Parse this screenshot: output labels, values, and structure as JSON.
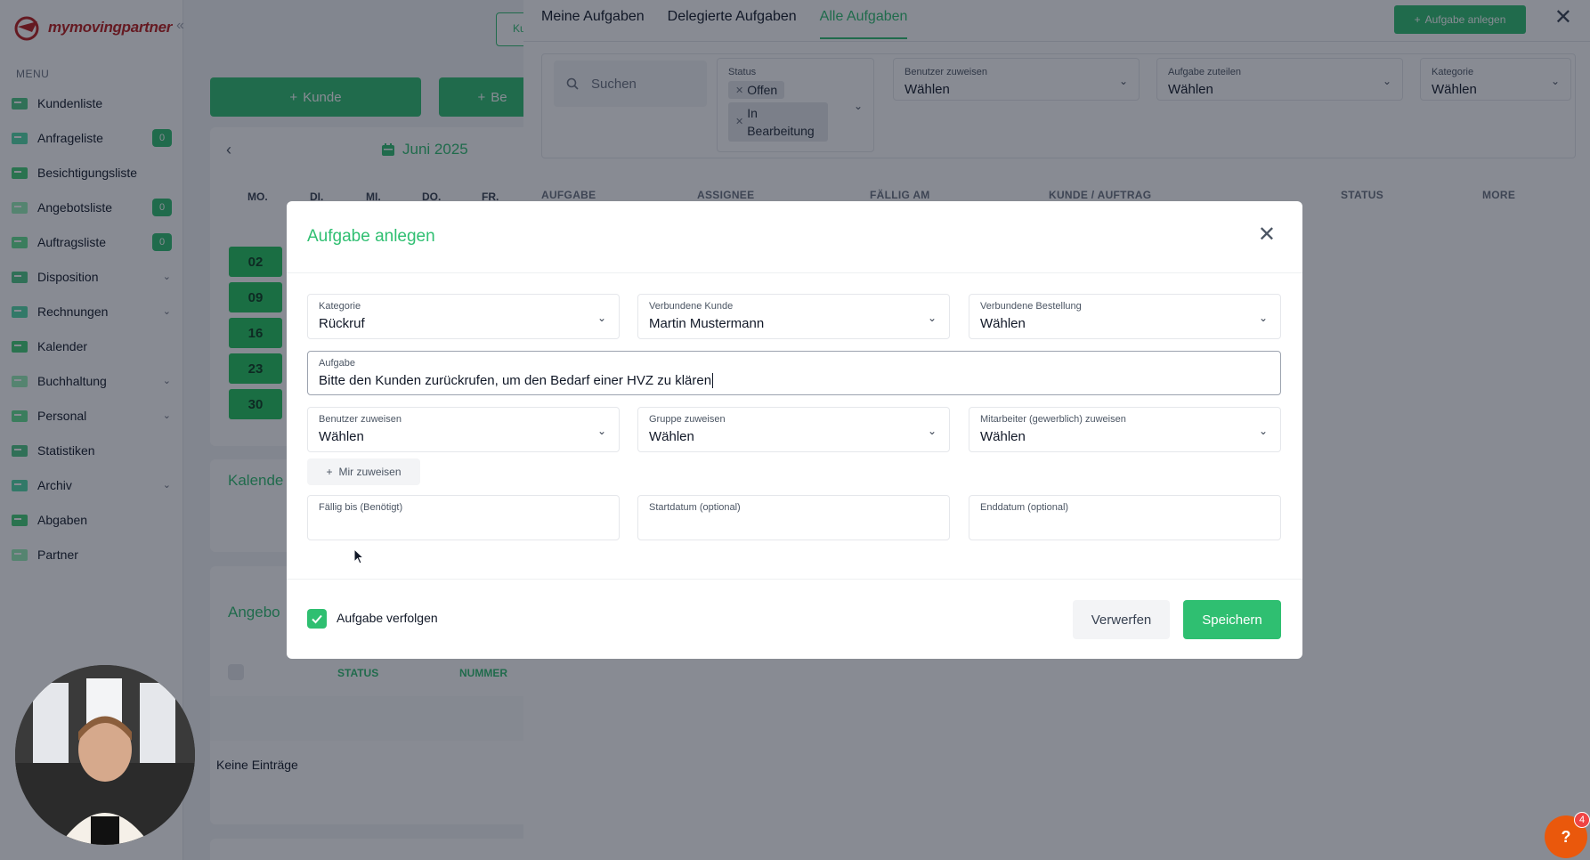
{
  "sidebar": {
    "brand": "mymovingpartner",
    "menu_label": "MENU",
    "items": [
      {
        "label": "Kundenliste",
        "badge": "",
        "has_chevron": false
      },
      {
        "label": "Anfrageliste",
        "badge": "0",
        "has_chevron": false
      },
      {
        "label": "Besichtigungsliste",
        "badge": "",
        "has_chevron": false
      },
      {
        "label": "Angebotsliste",
        "badge": "0",
        "has_chevron": false
      },
      {
        "label": "Auftragsliste",
        "badge": "0",
        "has_chevron": false
      },
      {
        "label": "Disposition",
        "badge": "",
        "has_chevron": true
      },
      {
        "label": "Rechnungen",
        "badge": "",
        "has_chevron": true
      },
      {
        "label": "Kalender",
        "badge": "",
        "has_chevron": false
      },
      {
        "label": "Buchhaltung",
        "badge": "",
        "has_chevron": true
      },
      {
        "label": "Personal",
        "badge": "",
        "has_chevron": true
      },
      {
        "label": "Statistiken",
        "badge": "",
        "has_chevron": false
      },
      {
        "label": "Archiv",
        "badge": "",
        "has_chevron": true
      },
      {
        "label": "Abgaben",
        "badge": "",
        "has_chevron": false
      },
      {
        "label": "Partner",
        "badge": "",
        "has_chevron": false
      }
    ]
  },
  "dashboard": {
    "add_customer_label": "Kunde",
    "second_button_label": "Be",
    "partial_tab_label": "Ku",
    "calendar_month": "Juni 2025",
    "weekdays": [
      "MO.",
      "DI.",
      "MI.",
      "DO.",
      "FR."
    ],
    "days": [
      "02",
      "09",
      "16",
      "23",
      "30"
    ],
    "calendar_section_title": "Kalende",
    "offers_section_title": "Angebo",
    "offers_columns": [
      "STATUS",
      "NUMMER"
    ],
    "empty_text": "Keine Einträge"
  },
  "tasks_panel": {
    "tabs": [
      "Meine Aufgaben",
      "Delegierte Aufgaben",
      "Alle Aufgaben"
    ],
    "active_tab": 2,
    "add_task_label": "Aufgabe anlegen",
    "search_placeholder": "Suchen",
    "status_filter": {
      "label": "Status",
      "chips": [
        "Offen",
        "In Bearbeitung"
      ]
    },
    "filters": [
      {
        "label": "Benutzer zuweisen",
        "value": "Wählen"
      },
      {
        "label": "Aufgabe zuteilen",
        "value": "Wählen"
      },
      {
        "label": "Kategorie",
        "value": "Wählen"
      }
    ],
    "columns": [
      "AUFGABE",
      "ASSIGNEE",
      "FÄLLIG AM",
      "KUNDE / AUFTRAG",
      "STATUS",
      "MORE"
    ]
  },
  "modal": {
    "title": "Aufgabe anlegen",
    "fields": {
      "kategorie": {
        "label": "Kategorie",
        "value": "Rückruf"
      },
      "kunde": {
        "label": "Verbundene Kunde",
        "value": "Martin Mustermann"
      },
      "bestellung": {
        "label": "Verbundene Bestellung",
        "value": "Wählen"
      },
      "aufgabe": {
        "label": "Aufgabe",
        "value": "Bitte den Kunden zurückrufen, um den Bedarf einer HVZ zu klären"
      },
      "benutzer": {
        "label": "Benutzer zuweisen",
        "value": "Wählen"
      },
      "gruppe": {
        "label": "Gruppe zuweisen",
        "value": "Wählen"
      },
      "mitarbeiter": {
        "label": "Mitarbeiter (gewerblich) zuweisen",
        "value": "Wählen"
      },
      "faellig": {
        "label": "Fällig bis (Benötigt)",
        "value": ""
      },
      "start": {
        "label": "Startdatum (optional)",
        "value": ""
      },
      "ende": {
        "label": "Enddatum (optional)",
        "value": ""
      }
    },
    "assign_me_label": "Mir zuweisen",
    "follow_label": "Aufgabe verfolgen",
    "follow_checked": true,
    "discard_label": "Verwerfen",
    "save_label": "Speichern"
  },
  "help": {
    "label": "?",
    "badge": "4"
  },
  "colors": {
    "brand": "#2fbf71",
    "logo": "#b91c1c",
    "help": "#ea580c"
  }
}
